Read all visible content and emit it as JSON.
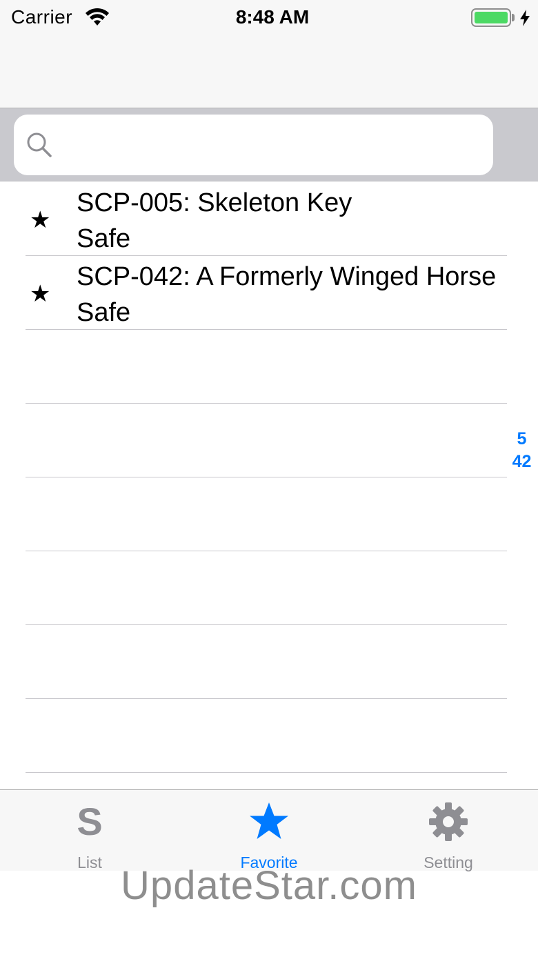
{
  "status_bar": {
    "carrier": "Carrier",
    "time": "8:48 AM",
    "battery_level": 1.0
  },
  "search": {
    "placeholder": "",
    "value": ""
  },
  "list": {
    "items": [
      {
        "title": "SCP-005: Skeleton Key",
        "class": "Safe",
        "star": "★"
      },
      {
        "title": "SCP-042: A Formerly Winged Horse",
        "class": "Safe",
        "star": "★"
      }
    ],
    "empty_rows": 6
  },
  "section_index": [
    "5",
    "42"
  ],
  "tab_bar": {
    "tabs": [
      {
        "label": "List",
        "icon": "s-letter-icon",
        "glyph": "S",
        "active": false
      },
      {
        "label": "Favorite",
        "icon": "star-icon",
        "active": true
      },
      {
        "label": "Setting",
        "icon": "gear-icon",
        "active": false
      }
    ]
  },
  "colors": {
    "accent": "#007aff",
    "inactive": "#8e8e93",
    "battery": "#4cd964"
  },
  "watermark": "UpdateStar.com"
}
